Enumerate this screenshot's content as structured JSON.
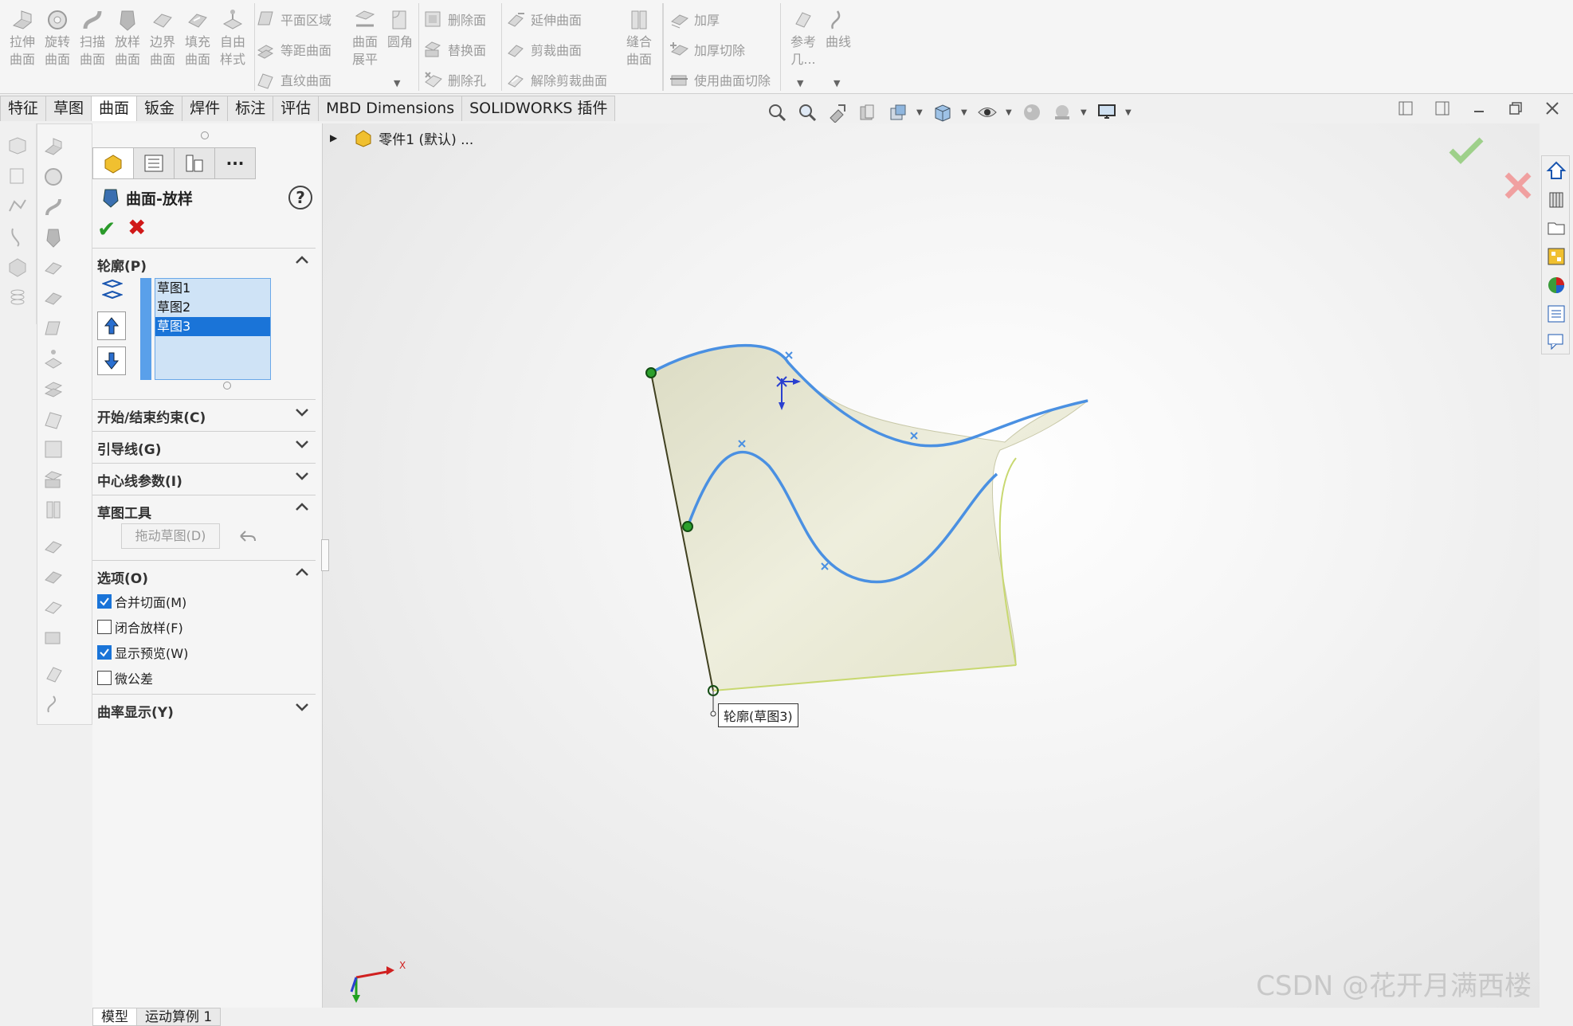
{
  "ribbon": {
    "group1": [
      {
        "label": "拉伸\n曲面",
        "icon": "extrude-surface-icon"
      },
      {
        "label": "旋转\n曲面",
        "icon": "revolve-surface-icon"
      },
      {
        "label": "扫描\n曲面",
        "icon": "sweep-surface-icon"
      },
      {
        "label": "放样\n曲面",
        "icon": "loft-surface-icon"
      },
      {
        "label": "边界\n曲面",
        "icon": "boundary-surface-icon"
      },
      {
        "label": "填充\n曲面",
        "icon": "fill-surface-icon"
      },
      {
        "label": "自由\n样式",
        "icon": "freeform-icon"
      }
    ],
    "group2_small": [
      "平面区域",
      "等距曲面",
      "直纹曲面"
    ],
    "group2_big": [
      {
        "label": "曲面\n展平"
      },
      {
        "label": "圆角"
      }
    ],
    "group3_small": [
      "删除面",
      "替换面",
      "删除孔"
    ],
    "group4_small": [
      "延伸曲面",
      "剪裁曲面",
      "解除剪裁曲面"
    ],
    "group5_big": {
      "label": "缝合\n曲面"
    },
    "group6_small": [
      "加厚",
      "加厚切除",
      "使用曲面切除"
    ],
    "group7_big": [
      {
        "label": "参考\n几..."
      },
      {
        "label": "曲线"
      }
    ]
  },
  "tabs": [
    "特征",
    "草图",
    "曲面",
    "钣金",
    "焊件",
    "标注",
    "评估",
    "MBD Dimensions",
    "SOLIDWORKS 插件"
  ],
  "active_tab": "曲面",
  "property_manager": {
    "title": "曲面-放样",
    "help": "?",
    "ok_symbol": "✔",
    "cancel_symbol": "✖",
    "profile_section": "轮廓(P)",
    "profiles": [
      "草图1",
      "草图2",
      "草图3"
    ],
    "selected_profile": "草图3",
    "sections": {
      "start_end": "开始/结束约束(C)",
      "guides": "引导线(G)",
      "centerline": "中心线参数(I)",
      "sketch_tools": "草图工具",
      "drag_sketch": "拖动草图(D)",
      "options": "选项(O)",
      "curvature": "曲率显示(Y)"
    },
    "options": [
      {
        "label": "合并切面(M)",
        "checked": true
      },
      {
        "label": "闭合放样(F)",
        "checked": false
      },
      {
        "label": "显示预览(W)",
        "checked": true
      },
      {
        "label": "微公差",
        "checked": false
      }
    ]
  },
  "feature_tree": {
    "item": "零件1 (默认) ..."
  },
  "callout": "轮廓(草图3)",
  "triad_x": "X",
  "bottom_tabs": [
    "模型",
    "运动算例 1"
  ],
  "active_bottom_tab": "模型",
  "watermark": "CSDN @花开月满西楼",
  "colors": {
    "accent": "#1a74d8",
    "curve": "#4a90e2",
    "surface": "#e6e6cc",
    "ok": "#2a9a2a",
    "cancel": "#d01818"
  }
}
